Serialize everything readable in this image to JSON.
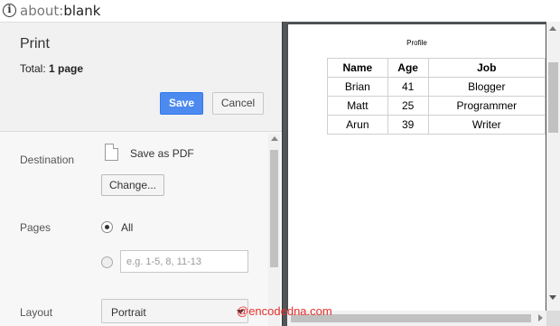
{
  "address_bar": {
    "scheme": "about:",
    "path": "blank",
    "icon": "info-icon"
  },
  "dialog": {
    "title": "Print",
    "total_label": "Total: ",
    "total_value": "1 page",
    "save_label": "Save",
    "cancel_label": "Cancel",
    "accent_color": "#4d8af0"
  },
  "settings": {
    "destination_label": "Destination",
    "destination_value": "Save as PDF",
    "change_label": "Change...",
    "pages_label": "Pages",
    "pages_all_label": "All",
    "pages_selected": "All",
    "pages_placeholder": "e.g. 1-5, 8, 11-13",
    "layout_label": "Layout",
    "layout_value": "Portrait"
  },
  "preview": {
    "title": "Profile",
    "table": {
      "headers": [
        "Name",
        "Age",
        "Job"
      ],
      "rows": [
        [
          "Brian",
          "41",
          "Blogger"
        ],
        [
          "Matt",
          "25",
          "Programmer"
        ],
        [
          "Arun",
          "39",
          "Writer"
        ]
      ]
    }
  },
  "watermark": "@encodedna.com"
}
